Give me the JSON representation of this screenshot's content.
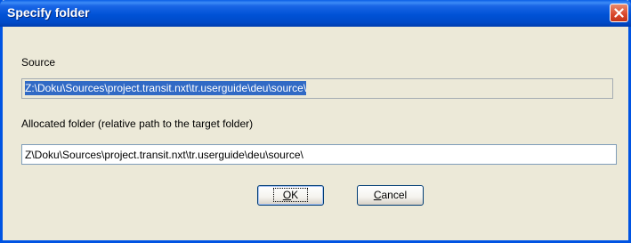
{
  "dialog": {
    "title": "Specify folder",
    "close_icon": "close-icon"
  },
  "source": {
    "label": "Source",
    "value": "Z:\\Doku\\Sources\\project.transit.nxt\\tr.userguide\\deu\\source\\"
  },
  "allocated": {
    "label": "Allocated folder (relative path to the target folder)",
    "value": "Z\\Doku\\Sources\\project.transit.nxt\\tr.userguide\\deu\\source\\"
  },
  "buttons": {
    "ok_mnemonic": "O",
    "ok_rest": "K",
    "cancel_mnemonic": "C",
    "cancel_rest": "ancel"
  },
  "colors": {
    "titlebar": "#0054e3",
    "selection": "#316ac5",
    "dialog_bg": "#ece9d8",
    "close_button": "#d9462a"
  }
}
